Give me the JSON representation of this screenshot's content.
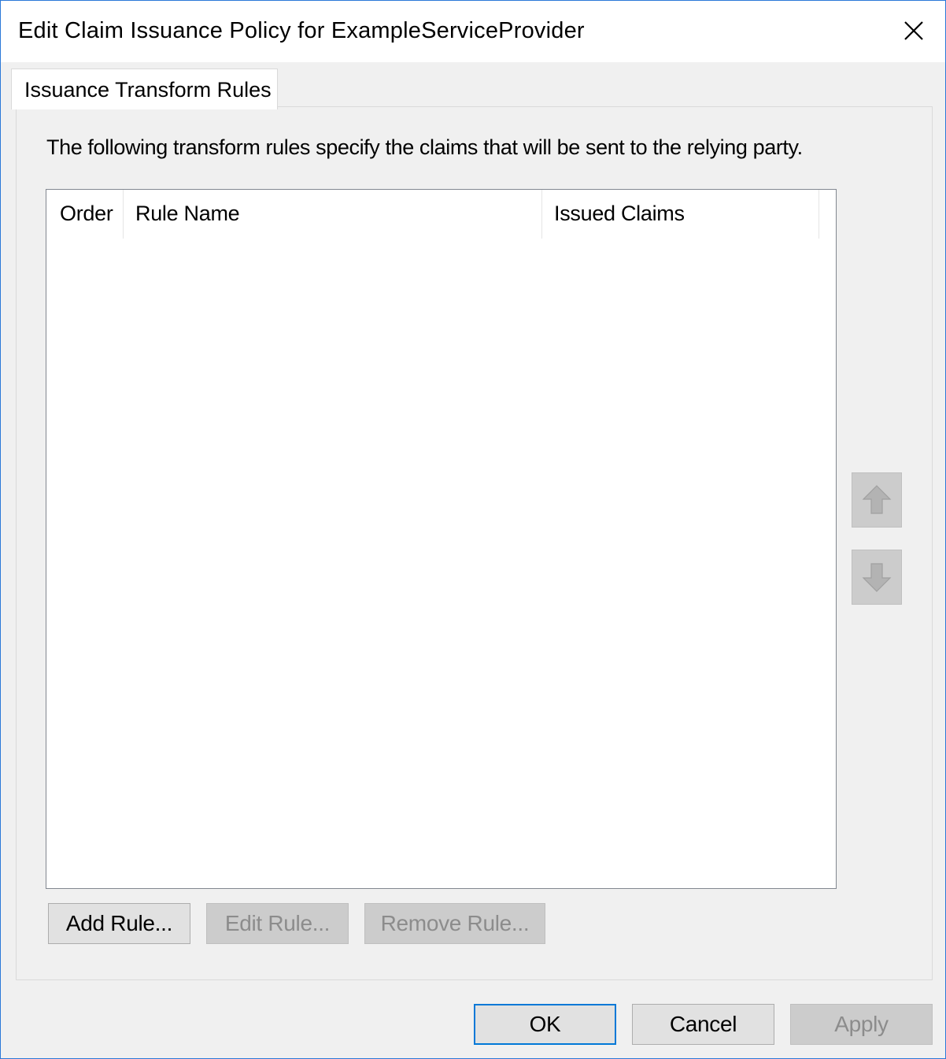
{
  "window": {
    "title": "Edit Claim Issuance Policy for ExampleServiceProvider",
    "close_icon": "close-icon"
  },
  "tabs": [
    {
      "label": "Issuance Transform Rules",
      "selected": true
    }
  ],
  "panel": {
    "description": "The following transform rules specify the claims that will be sent to the relying party.",
    "table": {
      "columns": [
        "Order",
        "Rule Name",
        "Issued Claims"
      ],
      "rows": []
    },
    "move_up_icon": "arrow-up-icon",
    "move_down_icon": "arrow-down-icon",
    "buttons": {
      "add": "Add Rule...",
      "edit": "Edit Rule...",
      "remove": "Remove Rule..."
    }
  },
  "footer": {
    "ok": "OK",
    "cancel": "Cancel",
    "apply": "Apply"
  },
  "colors": {
    "window_border": "#2b79d8",
    "default_button_border": "#0078d7",
    "disabled_button": "#cccccc"
  }
}
